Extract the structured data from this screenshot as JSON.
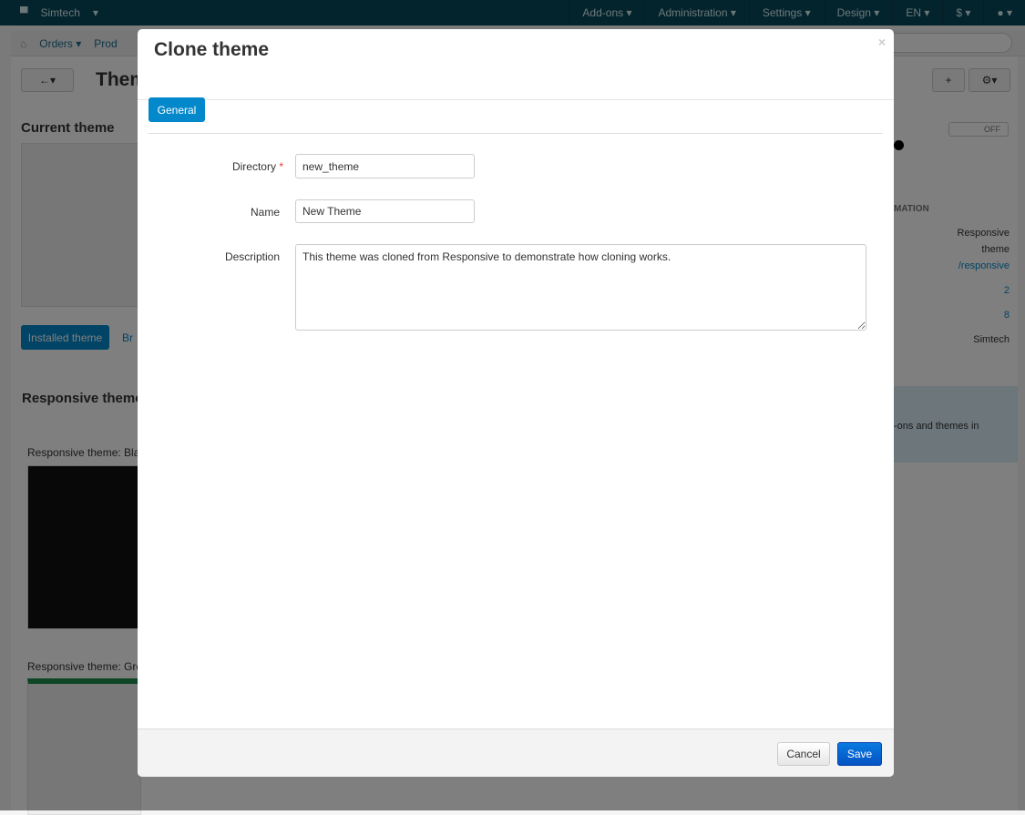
{
  "topbar": {
    "brand": "Simtech",
    "menu": [
      "Add-ons",
      "Administration",
      "Settings",
      "Design",
      "EN",
      "$"
    ]
  },
  "navbar": {
    "items": [
      "Orders",
      "Prod"
    ]
  },
  "background": {
    "page_title": "Them",
    "current_theme": "Current theme",
    "installed_button": "Installed theme",
    "browse_button": "Br",
    "toggle": "OFF",
    "section_title": "Responsive theme",
    "style_black": "Responsive theme: Blac",
    "style_green": "Responsive theme: Gree",
    "info_heading": "MATION",
    "info_values": [
      "Responsive",
      "theme",
      "/responsive",
      "2",
      "8",
      "Simtech"
    ],
    "notice": "-ons and themes in"
  },
  "modal": {
    "title": "Clone theme",
    "close": "×",
    "tab": "General",
    "fields": {
      "directory": {
        "label": "Directory",
        "required": "*",
        "value": "new_theme"
      },
      "name": {
        "label": "Name",
        "value": "New Theme"
      },
      "description": {
        "label": "Description",
        "value": "This theme was cloned from Responsive to demonstrate how cloning works."
      }
    },
    "cancel": "Cancel",
    "save": "Save"
  }
}
